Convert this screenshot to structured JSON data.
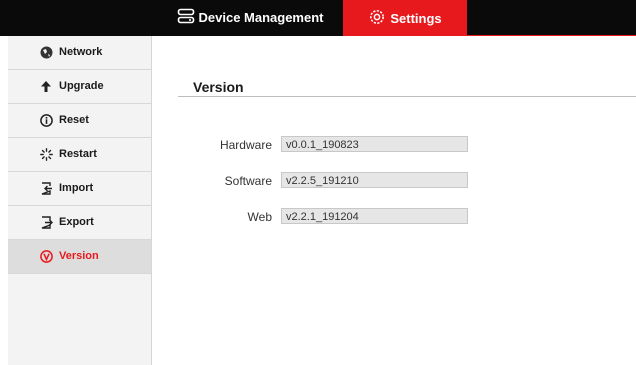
{
  "tabs": {
    "device_management": "Device Management",
    "settings": "Settings"
  },
  "sidebar": {
    "items": [
      {
        "label": "Network",
        "icon": "network-icon"
      },
      {
        "label": "Upgrade",
        "icon": "upgrade-arrow-icon"
      },
      {
        "label": "Reset",
        "icon": "info-circle-icon"
      },
      {
        "label": "Restart",
        "icon": "spinner-icon"
      },
      {
        "label": "Import",
        "icon": "import-icon"
      },
      {
        "label": "Export",
        "icon": "export-icon"
      },
      {
        "label": "Version",
        "icon": "version-circle-icon",
        "active": true
      }
    ]
  },
  "main": {
    "title": "Version",
    "fields": [
      {
        "label": "Hardware",
        "value": "v0.0.1_190823"
      },
      {
        "label": "Software",
        "value": "v2.2.5_191210"
      },
      {
        "label": "Web",
        "value": "v2.2.1_191204"
      }
    ]
  },
  "colors": {
    "accent": "#e8191d",
    "topbar": "#0a0a0a",
    "sidebar_bg": "#f3f3f3"
  }
}
